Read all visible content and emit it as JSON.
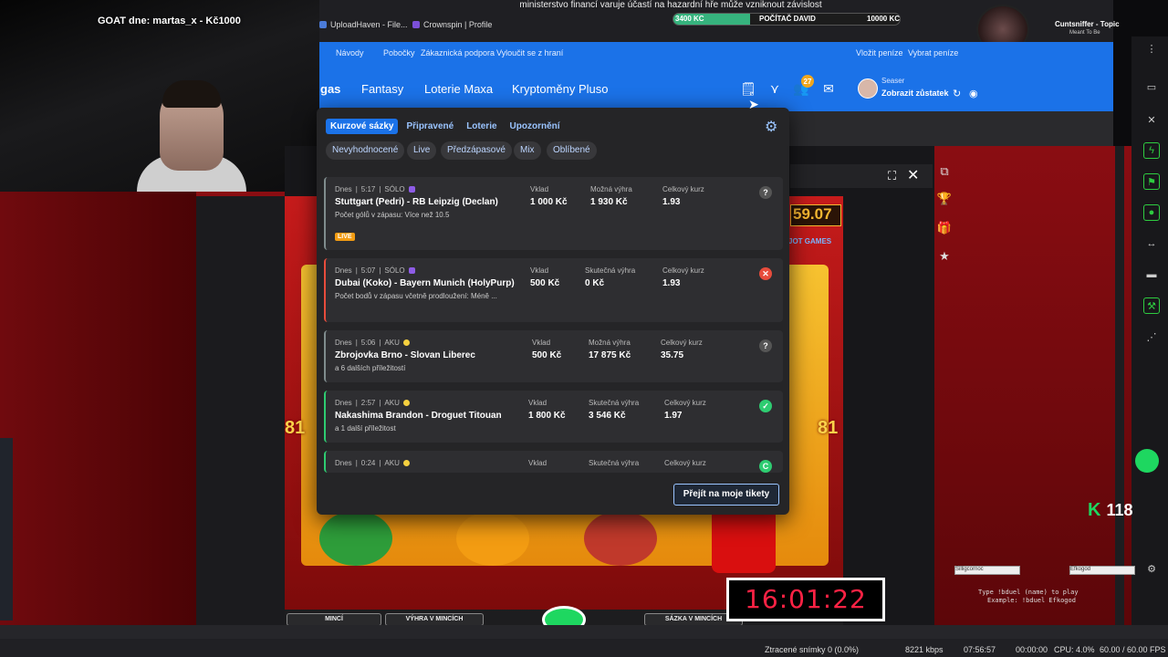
{
  "stream": {
    "goat_text": "GOAT dne: martas_x - Kč1000",
    "ministry_warning": "ministerstvo financí varuje účastí na hazardní hře může vzniknout závislost",
    "goal": {
      "left": "3400 KC",
      "middle": "POČÍTAČ DAVID",
      "right": "10000 KC",
      "progress": 0.34
    },
    "music": {
      "title": "Cuntsniffer - Topic",
      "subtitle": "Meant To Be"
    },
    "k_counter": "118",
    "k_logo": "K",
    "duel_name_1": "Silligcornoc",
    "duel_name_2": "Efkogod",
    "duel_msg_1": "Type !bduel (name) to play",
    "duel_msg_2": "Example: !bduel Efkogod",
    "timer": "16:01:22"
  },
  "browser": {
    "tabs": [
      "UploadHaven - File...",
      "Crownspin | Profile"
    ]
  },
  "site": {
    "top_links": [
      "Návody",
      "Pobočky",
      "Zákaznická podpora",
      "Vyloučit se z hraní"
    ],
    "deposit": "Vložit peníze",
    "withdraw": "Vybrat peníze",
    "nav": [
      "gas",
      "Fantasy",
      "Loterie Maxa",
      "Kryptoměny Pluso"
    ],
    "notif_count": "27",
    "user_name": "Seaser",
    "balance_label": "Zobrazit zůstatek"
  },
  "bets": {
    "tabs": [
      "Kurzové sázky",
      "Připravené",
      "Loterie",
      "Upozornění"
    ],
    "filters": [
      "Nevyhodnocené",
      "Live",
      "Předzápasové",
      "Mix",
      "Oblíbené"
    ],
    "tickets": [
      {
        "meta_day": "Dnes",
        "meta_time": "5:17",
        "meta_type": "SÓLO",
        "title": "Stuttgart (Pedri) - RB Leipzig (Declan)",
        "sub": "Počet gólů v zápasu: Více než 10.5",
        "h1": "Vklad",
        "v1": "1 000 Kč",
        "h2": "Možná výhra",
        "v2": "1 930 Kč",
        "h3": "Celkový kurz",
        "v3": "1.93",
        "status": "?",
        "live": "LIVE"
      },
      {
        "meta_day": "Dnes",
        "meta_time": "5:07",
        "meta_type": "SÓLO",
        "title": "Dubai (Koko) - Bayern Munich (HolyPurp)",
        "sub": "Počet bodů v zápasu včetně prodloužení: Méně ...",
        "h1": "Vklad",
        "v1": "500 Kč",
        "h2": "Skutečná výhra",
        "v2": "0 Kč",
        "h3": "Celkový kurz",
        "v3": "1.93",
        "status": "✕"
      },
      {
        "meta_day": "Dnes",
        "meta_time": "5:06",
        "meta_type": "AKU",
        "title": "Zbrojovka Brno - Slovan Liberec",
        "sub": "a 6 dalších příležitostí",
        "h1": "Vklad",
        "v1": "500 Kč",
        "h2": "Možná výhra",
        "v2": "17 875 Kč",
        "h3": "Celkový kurz",
        "v3": "35.75",
        "status": "?"
      },
      {
        "meta_day": "Dnes",
        "meta_time": "2:57",
        "meta_type": "AKU",
        "title": "Nakashima Brandon - Droguet Titouan",
        "sub": "a 1 další příležitost",
        "h1": "Vklad",
        "v1": "1 800 Kč",
        "h2": "Skutečná výhra",
        "v2": "3 546 Kč",
        "h3": "Celkový kurz",
        "v3": "1.97",
        "status": "✓"
      },
      {
        "meta_day": "Dnes",
        "meta_time": "0:24",
        "meta_type": "AKU",
        "h1": "Vklad",
        "h2": "Skutečná výhra",
        "h3": "Celkový kurz",
        "status": "C"
      }
    ],
    "my_tickets_button": "Přejít na moje tikety"
  },
  "game": {
    "amount": "59.07",
    "brand": "JOT GAMES",
    "num_81": "81",
    "buttons": [
      "MINCÍ",
      "VÝHRA V MINCÍCH",
      "SÁZKA V MINCÍCH"
    ]
  },
  "obs_status": {
    "dropped": "Ztracené snímky 0 (0.0%)",
    "bitrate": "8221 kbps",
    "rec_time": "07:56:57",
    "stream_time": "00:00:00",
    "cpu": "CPU: 4.0%",
    "fps": "60.00 / 60.00 FPS"
  },
  "colors": {
    "brand_blue": "#1b72e8",
    "win_green": "#2ecc71",
    "lose_red": "#e74c3c",
    "panel": "#252527"
  }
}
